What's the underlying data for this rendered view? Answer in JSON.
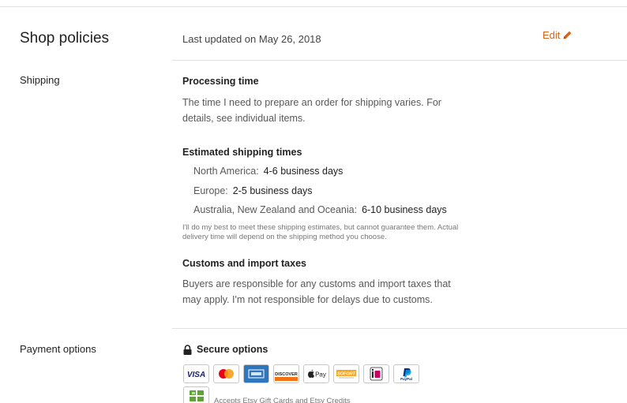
{
  "header": {
    "title": "Shop policies",
    "last_updated": "Last updated on May 26, 2018",
    "edit_label": "Edit"
  },
  "shipping": {
    "label": "Shipping",
    "processing_title": "Processing time",
    "processing_text": "The time I need to prepare an order for shipping varies. For details, see individual items.",
    "estimated_title": "Estimated shipping times",
    "estimates": [
      {
        "region": "North America:",
        "time": "4-6 business days"
      },
      {
        "region": "Europe:",
        "time": "2-5 business days"
      },
      {
        "region": "Australia, New Zealand and Oceania:",
        "time": "6-10 business days"
      }
    ],
    "disclaimer": "I'll do my best to meet these shipping estimates, but cannot guarantee them. Actual delivery time will depend on the shipping method you choose.",
    "customs_title": "Customs and import taxes",
    "customs_text": "Buyers are responsible for any customs and import taxes that may apply. I'm not responsible for delays due to customs."
  },
  "payment": {
    "label": "Payment options",
    "secure_label": "Secure options",
    "methods": [
      {
        "name": "visa-icon",
        "text": "VISA"
      },
      {
        "name": "mastercard-icon",
        "text": ""
      },
      {
        "name": "amex-icon",
        "text": ""
      },
      {
        "name": "discover-icon",
        "text": "DISCOVER"
      },
      {
        "name": "apple-pay-icon",
        "text": "Pay"
      },
      {
        "name": "sofort-icon",
        "text": "SOFORT"
      },
      {
        "name": "ideal-icon",
        "text": "iDEAL"
      },
      {
        "name": "paypal-icon",
        "text": "PayPal"
      }
    ],
    "gift_text": "Accepts Etsy Gift Cards and Etsy Credits"
  },
  "colors": {
    "accent": "#d5641c",
    "text": "#222222",
    "muted": "#595959",
    "rule": "#e1e1e1"
  }
}
